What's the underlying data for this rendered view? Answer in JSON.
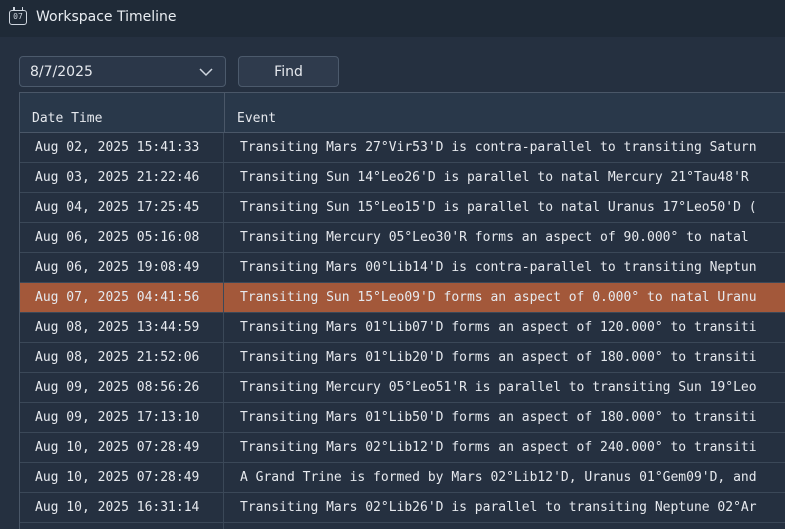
{
  "window": {
    "icon_text": "07",
    "title": "Workspace Timeline"
  },
  "toolbar": {
    "date_value": "8/7/2025",
    "find_label": "Find"
  },
  "table": {
    "columns": [
      "Date Time",
      "Event"
    ],
    "selected_index": 5,
    "rows": [
      {
        "datetime": "Aug 02, 2025 15:41:33",
        "event": "Transiting Mars 27°Vir53'D is contra-parallel to transiting Saturn"
      },
      {
        "datetime": "Aug 03, 2025 21:22:46",
        "event": "Transiting Sun 14°Leo26'D is parallel to natal Mercury 21°Tau48'R"
      },
      {
        "datetime": "Aug 04, 2025 17:25:45",
        "event": "Transiting Sun 15°Leo15'D is parallel to natal Uranus 17°Leo50'D ("
      },
      {
        "datetime": "Aug 06, 2025 05:16:08",
        "event": "Transiting Mercury 05°Leo30'R forms an aspect of 90.000° to natal"
      },
      {
        "datetime": "Aug 06, 2025 19:08:49",
        "event": "Transiting Mars 00°Lib14'D is contra-parallel to transiting Neptun"
      },
      {
        "datetime": "Aug 07, 2025 04:41:56",
        "event": "Transiting Sun 15°Leo09'D forms an aspect of 0.000° to natal Uranu"
      },
      {
        "datetime": "Aug 08, 2025 13:44:59",
        "event": "Transiting Mars 01°Lib07'D forms an aspect of 120.000° to transiti"
      },
      {
        "datetime": "Aug 08, 2025 21:52:06",
        "event": "Transiting Mars 01°Lib20'D forms an aspect of 180.000° to transiti"
      },
      {
        "datetime": "Aug 09, 2025 08:56:26",
        "event": "Transiting Mercury 05°Leo51'R is parallel to transiting Sun 19°Leo"
      },
      {
        "datetime": "Aug 09, 2025 17:13:10",
        "event": "Transiting Mars 01°Lib50'D forms an aspect of 180.000° to transiti"
      },
      {
        "datetime": "Aug 10, 2025 07:28:49",
        "event": "Transiting Mars 02°Lib12'D forms an aspect of 240.000° to transiti"
      },
      {
        "datetime": "Aug 10, 2025 07:28:49",
        "event": "A Grand Trine is formed by Mars 02°Lib12'D, Uranus 01°Gem09'D, and"
      },
      {
        "datetime": "Aug 10, 2025 16:31:14",
        "event": "Transiting Mars 02°Lib26'D is parallel to transiting Neptune 02°Ar"
      },
      {
        "datetime": "",
        "event": ""
      }
    ]
  },
  "colors": {
    "background": "#253040",
    "titlebar": "#1f2a37",
    "selected_row": "#a3583a"
  }
}
